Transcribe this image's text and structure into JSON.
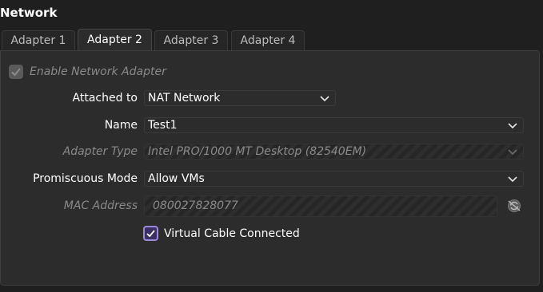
{
  "section_title": "Network",
  "tabs": [
    {
      "label": "Adapter 1",
      "active": false
    },
    {
      "label": "Adapter 2",
      "active": true
    },
    {
      "label": "Adapter 3",
      "active": false
    },
    {
      "label": "Adapter 4",
      "active": false
    }
  ],
  "enable_adapter": {
    "label": "Enable Network Adapter",
    "checked": true,
    "enabled": false
  },
  "attached_to": {
    "label": "Attached to",
    "value": "NAT Network"
  },
  "name": {
    "label": "Name",
    "value": "Test1"
  },
  "adapter_type": {
    "label": "Adapter Type",
    "value": "Intel PRO/1000 MT Desktop (82540EM)",
    "enabled": false
  },
  "promiscuous_mode": {
    "label": "Promiscuous Mode",
    "value": "Allow VMs"
  },
  "mac_address": {
    "label": "MAC Address",
    "value": "080027828077",
    "enabled": false
  },
  "cable_connected": {
    "label": "Virtual Cable Connected",
    "checked": true
  },
  "colors": {
    "accent": "#9b8ad8",
    "background": "#1f1f1f",
    "panel": "#2c2c2c"
  }
}
